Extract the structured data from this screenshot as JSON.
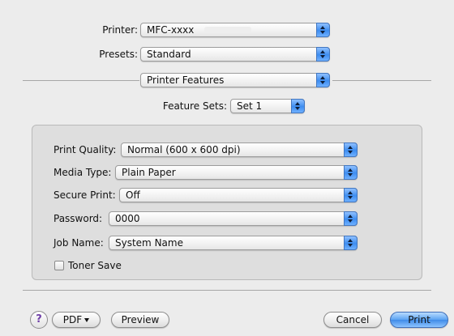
{
  "header": {
    "printer": {
      "label": "Printer:",
      "value": "MFC-xxxx"
    },
    "presets": {
      "label": "Presets:",
      "value": "Standard"
    },
    "section": {
      "value": "Printer Features"
    },
    "feature_sets": {
      "label": "Feature Sets:",
      "value": "Set 1"
    }
  },
  "options": {
    "print_quality": {
      "label": "Print Quality:",
      "value": "Normal (600 x 600 dpi)"
    },
    "media_type": {
      "label": "Media Type:",
      "value": "Plain Paper"
    },
    "secure_print": {
      "label": "Secure Print:",
      "value": "Off"
    },
    "password": {
      "label": "Password:",
      "value": "0000"
    },
    "job_name": {
      "label": "Job Name:",
      "value": "System Name"
    },
    "toner_save": {
      "label": "Toner Save",
      "checked": false
    }
  },
  "footer": {
    "help": "?",
    "pdf": "PDF",
    "preview": "Preview",
    "cancel": "Cancel",
    "print": "Print"
  },
  "icons": {
    "popup_arrows": "up-down-arrows-icon",
    "pdf_menu": "triangle-down-icon",
    "help": "question-mark-icon"
  },
  "colors": {
    "window_bg": "#ececec",
    "group_bg": "#dedede",
    "accent_blue": "#3d8df0"
  }
}
